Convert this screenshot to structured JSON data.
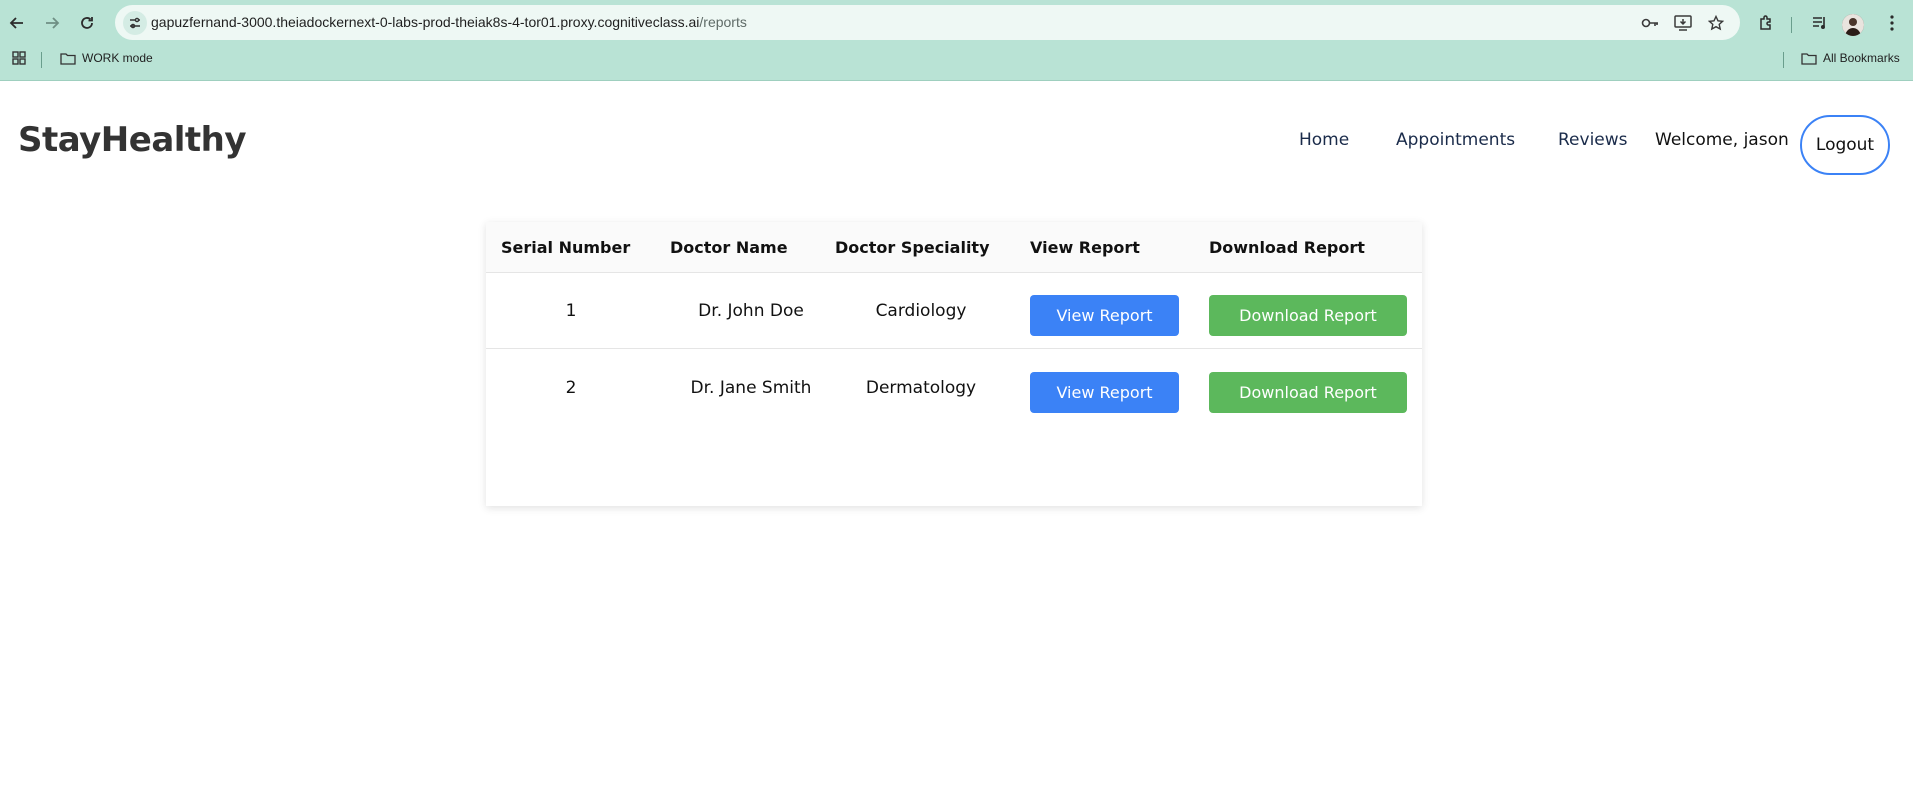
{
  "browser": {
    "url_host": "gapuzfernand-3000.theiadockernext-0-labs-prod-theiak8s-4-tor01.proxy.cognitiveclass.ai",
    "url_path": "/reports",
    "bookmarks": {
      "work_mode": "WORK mode",
      "all_bookmarks": "All Bookmarks"
    }
  },
  "header": {
    "brand": "StayHealthy",
    "nav": {
      "home": "Home",
      "appointments": "Appointments",
      "reviews": "Reviews"
    },
    "welcome": "Welcome, jason",
    "logout": "Logout"
  },
  "reports": {
    "columns": {
      "serial": "Serial Number",
      "doctor": "Doctor Name",
      "speciality": "Doctor Speciality",
      "view": "View Report",
      "download": "Download Report"
    },
    "rows": [
      {
        "serial": "1",
        "doctor": "Dr. John Doe",
        "speciality": "Cardiology",
        "view": "View Report",
        "download": "Download Report"
      },
      {
        "serial": "2",
        "doctor": "Dr. Jane Smith",
        "speciality": "Dermatology",
        "view": "View Report",
        "download": "Download Report"
      }
    ]
  },
  "colors": {
    "chrome": "#b9e3d5",
    "primary_blue": "#3b82f6",
    "download_green": "#5cb85c"
  }
}
